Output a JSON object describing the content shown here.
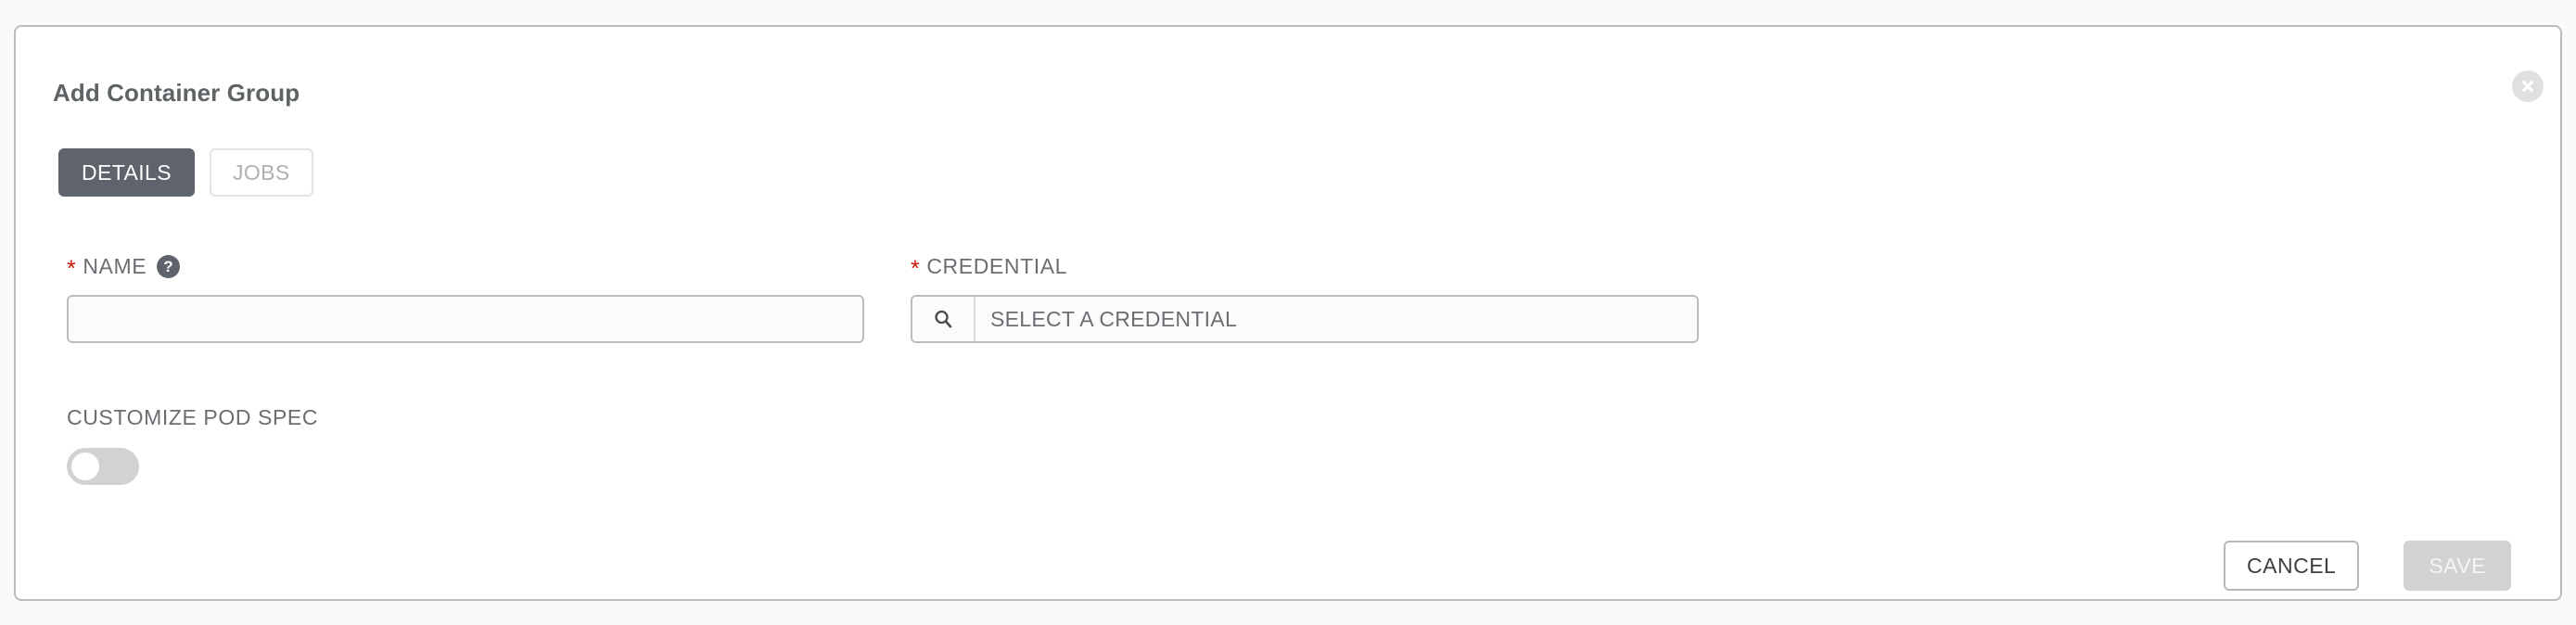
{
  "card": {
    "title": "Add Container Group",
    "close_icon": "close-circle-icon"
  },
  "tabs": [
    {
      "label": "DETAILS",
      "active": true
    },
    {
      "label": "JOBS",
      "active": false
    }
  ],
  "form": {
    "name": {
      "label": "NAME",
      "required_marker": "*",
      "help_icon": "question-circle-icon",
      "help_glyph": "?",
      "value": "",
      "placeholder": ""
    },
    "credential": {
      "label": "CREDENTIAL",
      "required_marker": "*",
      "search_icon": "search-icon",
      "value": "",
      "placeholder": "SELECT A CREDENTIAL"
    },
    "customize_pod_spec": {
      "label": "CUSTOMIZE POD SPEC",
      "toggle_state": "off"
    }
  },
  "footer": {
    "cancel_label": "CANCEL",
    "save_label": "SAVE"
  },
  "colors": {
    "page_background": "#fafafa",
    "card_background": "#ffffff",
    "card_border": "#bcbcbc",
    "tab_active_background": "#5e636c",
    "required_asterisk": "#c9190b",
    "label_text": "#6a6e73",
    "title_text": "#5e6366",
    "toggle_off": "#d2d2d2",
    "save_disabled": "#d2d2d2"
  }
}
